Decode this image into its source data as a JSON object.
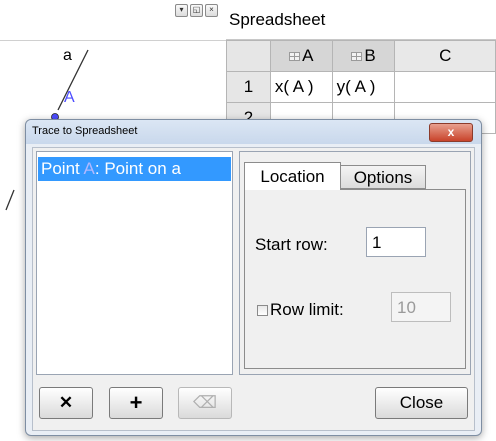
{
  "graphics": {
    "line_label": "a",
    "point_label": "A",
    "point_color": "#4d4dff",
    "header_icons": [
      "menu-icon",
      "detach-icon",
      "close-icon"
    ]
  },
  "spreadsheet": {
    "title": "Spreadsheet",
    "columns": [
      "A",
      "B",
      "C"
    ],
    "rows": [
      {
        "num": "1",
        "cells": [
          "x( A )",
          "y( A )",
          ""
        ]
      },
      {
        "num": "2",
        "cells": [
          "",
          "",
          ""
        ]
      }
    ]
  },
  "dialog": {
    "title": "Trace to Spreadsheet",
    "close_glyph": "x",
    "list_items": [
      {
        "prefix": "Point ",
        "name": "A",
        "suffix": ": Point on a"
      }
    ],
    "tabs": [
      {
        "label": "Location",
        "selected": true
      },
      {
        "label": "Options",
        "selected": false
      }
    ],
    "start_row_label": "Start row:",
    "start_row_value": "1",
    "row_limit_label": "Row limit:",
    "row_limit_value": "10",
    "row_limit_checked": false,
    "buttons": {
      "remove_glyph": "✕",
      "add_glyph": "+",
      "erase_glyph": "⌫",
      "close_label": "Close"
    }
  }
}
